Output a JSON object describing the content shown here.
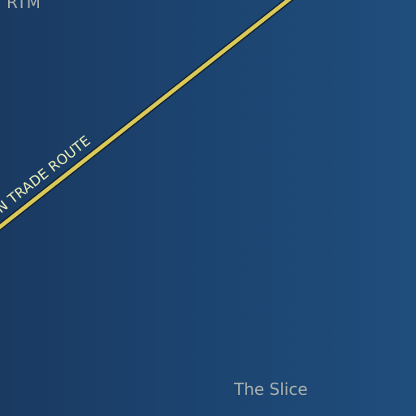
{
  "map": {
    "background_colors": [
      "#1a3a61",
      "#1f4d7c"
    ],
    "route": {
      "label": "N TRADE ROUTE",
      "color": "#d9c85a",
      "outline_color": "#0f1d2b"
    },
    "labels": {
      "region": "The Slice",
      "corner": "RTM"
    }
  }
}
